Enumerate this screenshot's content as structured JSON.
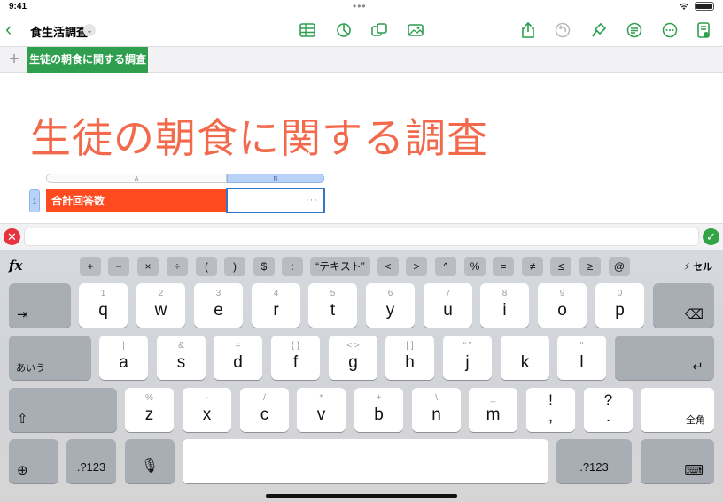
{
  "status_bar": {
    "time": "9:41",
    "dots": "•••"
  },
  "toolbar": {
    "back_glyph": "‹",
    "doc_title": "食生活調査",
    "title_menu_glyph": "⌄",
    "icons": [
      "table-icon",
      "chart-icon",
      "shape-icon",
      "media-icon",
      "share-icon",
      "undo-icon",
      "format-brush-icon",
      "collaborate-icon",
      "more-icon",
      "document-setup-icon"
    ]
  },
  "tabbar": {
    "add_glyph": "+",
    "active_sheet": "生徒の朝食に関する調査"
  },
  "canvas": {
    "title": "生徒の朝食に関する調査",
    "title_color": "#f26a4b",
    "col_a": "A",
    "col_b": "B",
    "row_1": "1",
    "cell_a1": "合計回答数",
    "cell_a1_color": "#ff4a1f",
    "cell_b1_more": "···"
  },
  "formula_bar": {
    "cancel_glyph": "✕",
    "accept_glyph": "✓",
    "value": ""
  },
  "keyboard": {
    "fx": "fx",
    "fx_keys": [
      "+",
      "−",
      "×",
      "÷",
      "(",
      ")",
      "$",
      ":",
      "“テキスト”",
      "<",
      ">",
      "^",
      "%",
      "=",
      "≠",
      "≤",
      "≥",
      "@"
    ],
    "cell_toggle": "⚡ セル",
    "row1": [
      {
        "sub": "1",
        "main": "q"
      },
      {
        "sub": "2",
        "main": "w"
      },
      {
        "sub": "3",
        "main": "e"
      },
      {
        "sub": "4",
        "main": "r"
      },
      {
        "sub": "5",
        "main": "t"
      },
      {
        "sub": "6",
        "main": "y"
      },
      {
        "sub": "7",
        "main": "u"
      },
      {
        "sub": "8",
        "main": "i"
      },
      {
        "sub": "9",
        "main": "o"
      },
      {
        "sub": "0",
        "main": "p"
      }
    ],
    "row2": [
      {
        "sub": "|",
        "main": "a"
      },
      {
        "sub": "&",
        "main": "s"
      },
      {
        "sub": "=",
        "main": "d"
      },
      {
        "sub": "{ }",
        "main": "f"
      },
      {
        "sub": "< >",
        "main": "g"
      },
      {
        "sub": "[ ]",
        "main": "h"
      },
      {
        "sub": "“ ”",
        "main": "j"
      },
      {
        "sub": ":",
        "main": "k"
      },
      {
        "sub": "\"",
        "main": "l"
      }
    ],
    "row3": [
      {
        "sub": "%",
        "main": "z"
      },
      {
        "sub": "-",
        "main": "x"
      },
      {
        "sub": "/",
        "main": "c"
      },
      {
        "sub": "*",
        "main": "v"
      },
      {
        "sub": "+",
        "main": "b"
      },
      {
        "sub": "\\",
        "main": "n"
      },
      {
        "sub": "_",
        "main": "m"
      },
      {
        "sub": "!",
        "main": ","
      },
      {
        "sub": "?",
        "main": "."
      }
    ],
    "tab_glyph": "⇥",
    "delete_glyph": "⌫",
    "kana_label": "あいう",
    "return_glyph": "↵",
    "shift_glyph": "⇧",
    "zenkaku_label": "全角",
    "globe_glyph": "⊕",
    "num_label": ".?123",
    "mic_glyph": "🎙",
    "hide_kb_glyph": "⌨"
  }
}
